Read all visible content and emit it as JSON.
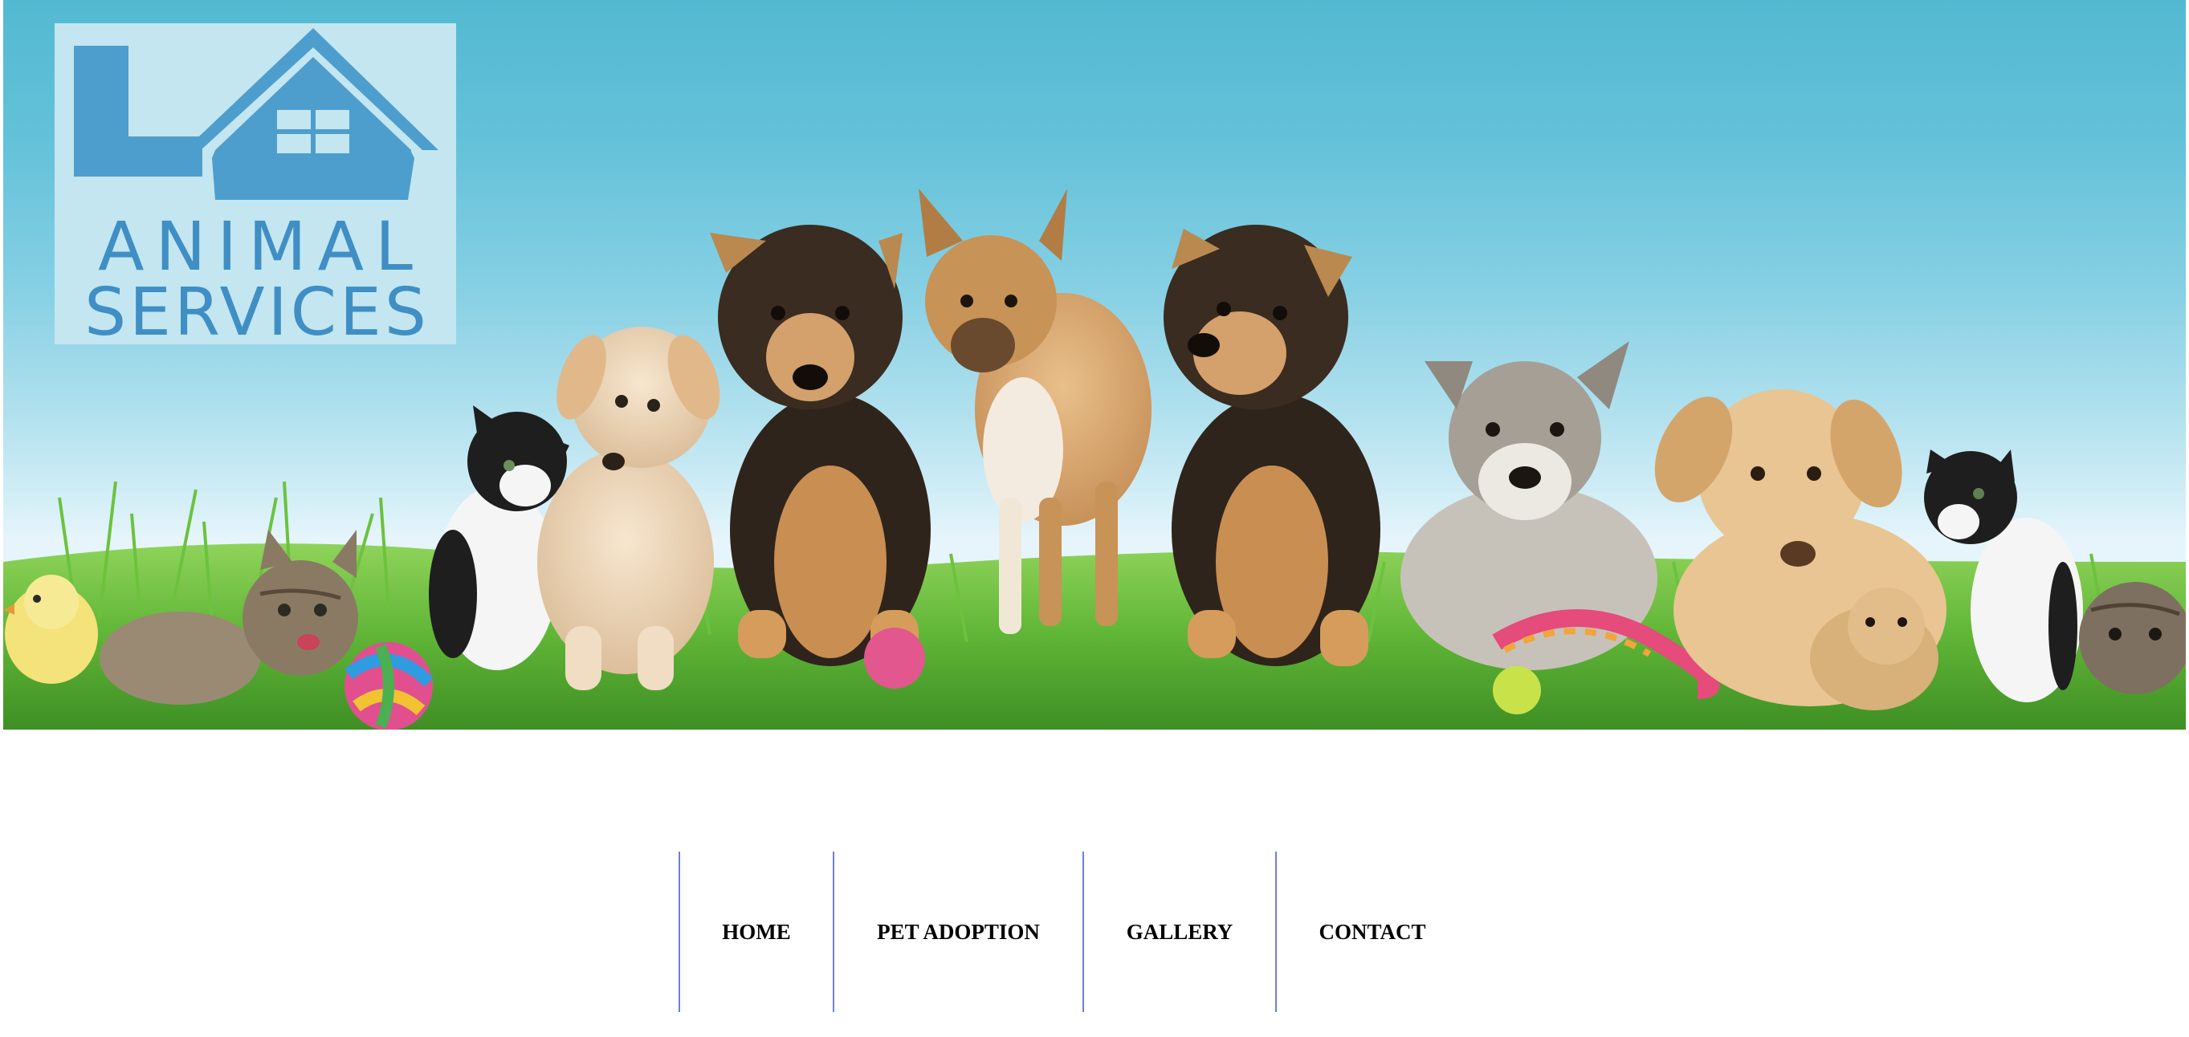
{
  "logo": {
    "line1": "ANIMAL",
    "line2": "SERVICES",
    "icon": "house-logo-icon",
    "color": "#3f8fc5",
    "background": "#c3e6f0"
  },
  "hero": {
    "image": "pets-in-grass-banner",
    "sky_color": "#53b9d2",
    "grass_color": "#5fb536"
  },
  "nav": {
    "items": [
      {
        "label": "HOME"
      },
      {
        "label": "PET ADOPTION"
      },
      {
        "label": "GALLERY"
      },
      {
        "label": "CONTACT"
      }
    ],
    "divider_color": "#6c7fe0"
  }
}
